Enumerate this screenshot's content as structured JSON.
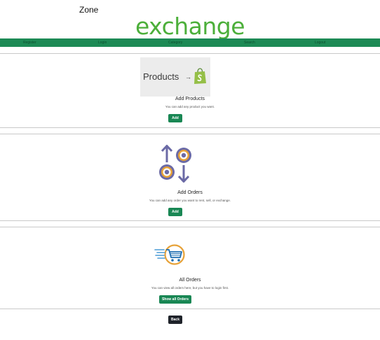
{
  "header": {
    "zone_text": "Zone",
    "logo_text": "exchange"
  },
  "nav": {
    "items": [
      "Register",
      "Login",
      "Category",
      "Search",
      "Logout"
    ]
  },
  "products": {
    "image_text": "Products",
    "image_arrow": "→",
    "title": "Add Products",
    "description": "You can add any product you want.",
    "button": "Add"
  },
  "orders": {
    "title": "Add Orders",
    "description": "You can add any order you want to rent, sell, or exchange.",
    "button": "Add"
  },
  "all_orders": {
    "title": "All Orders",
    "description": "You can view all orders here, but you have to login first.",
    "button": "Show all Orders"
  },
  "footer": {
    "back_button": "Back"
  },
  "colors": {
    "brand_green": "#4caf3a",
    "navbar": "#1d8a55",
    "button_green": "#198754",
    "button_dark": "#1f232a",
    "icon_purple": "#6b6aa6",
    "icon_orange": "#e7a238"
  }
}
